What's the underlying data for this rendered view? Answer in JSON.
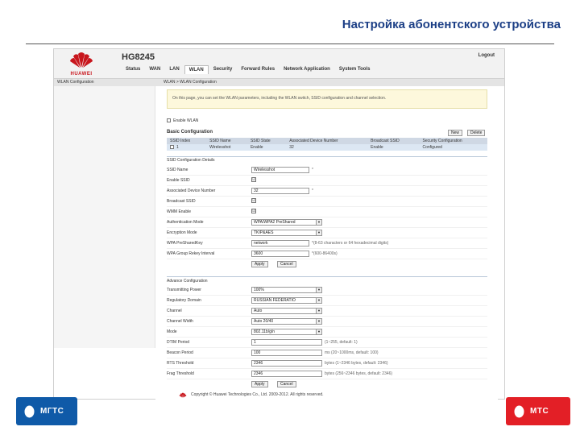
{
  "slide": {
    "title": "Настройка абонентского устройства"
  },
  "router": {
    "brand": "HUAWEI",
    "model": "HG8245",
    "logout": "Logout",
    "nav": [
      "Status",
      "WAN",
      "LAN",
      "WLAN",
      "Security",
      "Forward Rules",
      "Network Application",
      "System Tools"
    ],
    "nav_active": "WLAN",
    "left_sub": "WLAN Configuration",
    "breadcrumb": "WLAN > WLAN Configuration",
    "note": "On this page, you can set the WLAN parameters, including the WLAN switch, SSID configuration and channel selection.",
    "enable_wlan": "Enable WLAN",
    "basic_title": "Basic Configuration",
    "btn_new": "New",
    "btn_delete": "Delete",
    "ssid_table": {
      "headers": [
        "SSID Index",
        "SSID Name",
        "SSID State",
        "Associated Device Number",
        "Broadcast SSID",
        "Security Configuration"
      ],
      "rows": [
        [
          "1",
          "Wirelesshot",
          "Enable",
          "32",
          "Enable",
          "Configured"
        ]
      ]
    },
    "detail_title": "SSID Configuration Details",
    "detail": {
      "ssid_name": {
        "label": "SSID Name",
        "value": "Wirelesshot",
        "mark": "*"
      },
      "enable_ssid": {
        "label": "Enable SSID",
        "value": "☑"
      },
      "assoc_num": {
        "label": "Associated Device Number",
        "value": "32",
        "mark": "*"
      },
      "broadcast": {
        "label": "Broadcast SSID",
        "value": "☑"
      },
      "wmm": {
        "label": "WMM Enable",
        "value": "☑"
      },
      "auth_mode": {
        "label": "Authentication Mode",
        "value": "WPA/WPA2 PreShared"
      },
      "encryption": {
        "label": "Encryption Mode",
        "value": "TKIP&AES"
      },
      "psk": {
        "label": "WPA PreSharedKey",
        "value": "network",
        "hint": "*(8-63 characters or 64 hexadecimal digits)"
      },
      "rekey": {
        "label": "WPA Group Rekey Interval",
        "value": "3600",
        "hint": "*(600-86400s)"
      }
    },
    "apply": "Apply",
    "cancel": "Cancel",
    "adv_title": "Advance Configuration",
    "adv": {
      "power": {
        "label": "Transmitting Power",
        "value": "100%"
      },
      "domain": {
        "label": "Regulatory Domain",
        "value": "RUSSIAN FEDERATIO"
      },
      "channel": {
        "label": "Channel",
        "value": "Auto"
      },
      "width": {
        "label": "Channel Width",
        "value": "Auto 20/40"
      },
      "mode": {
        "label": "Mode",
        "value": "802.11b/g/n"
      },
      "dtim": {
        "label": "DTIM Period",
        "value": "1",
        "hint": "(1~255, default: 1)"
      },
      "beacon": {
        "label": "Beacon Period",
        "value": "100",
        "hint": "ms (20~1000ms, default: 100)"
      },
      "rts": {
        "label": "RTS Threshold",
        "value": "2346",
        "hint": "bytes (1~2346 bytes, default: 2346)"
      },
      "frag": {
        "label": "Frag Threshold",
        "value": "2346",
        "hint": "bytes (256~2346 bytes, default: 2346)"
      }
    },
    "footer": "Copyright © Huawei Technologies Co., Ltd. 2009-2012. All rights reserved."
  },
  "brands": {
    "left": "МГТС",
    "right": "МТС"
  },
  "colors": {
    "title": "#1c3f86",
    "huawei_red": "#c8161d",
    "mgts_blue": "#0f5aa8",
    "mts_red": "#e31f26"
  },
  "icons": {
    "huawei_logo": "huawei-petals",
    "brand_logo": "egg"
  }
}
